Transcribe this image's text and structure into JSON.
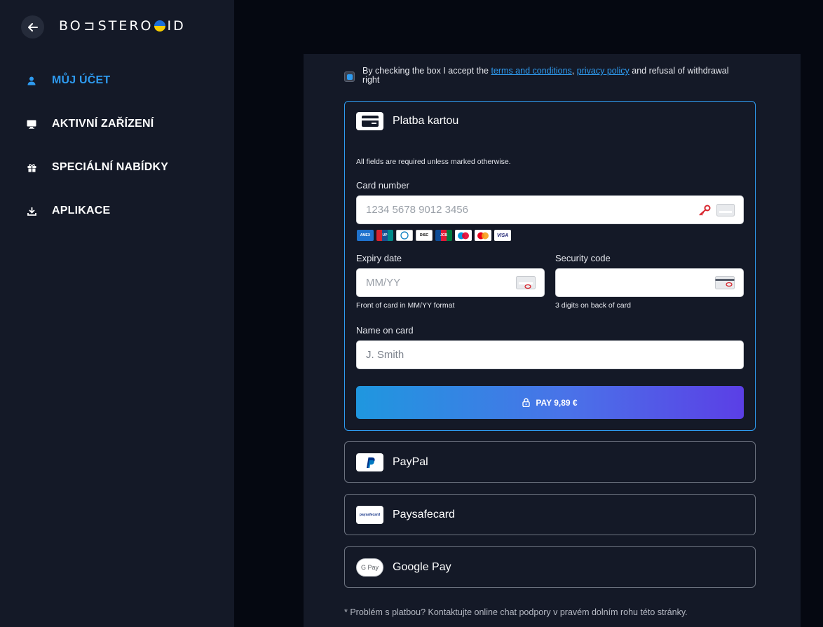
{
  "logo": {
    "before": "BO",
    "middle": "ST",
    "ost": "OSTERO",
    "text_left": "BO",
    "text_right": "STERO",
    "end": "ID"
  },
  "nav": [
    {
      "label": "MŮJ ÚČET",
      "icon": "user-icon",
      "active": true
    },
    {
      "label": "AKTIVNÍ ZAŘÍZENÍ",
      "icon": "monitor-icon",
      "active": false
    },
    {
      "label": "SPECIÁLNÍ NABÍDKY",
      "icon": "gift-icon",
      "active": false
    },
    {
      "label": "APLIKACE",
      "icon": "download-icon",
      "active": false
    }
  ],
  "consent": {
    "prefix": "By checking the box I accept the ",
    "terms": "terms and conditions",
    "comma": ",",
    "privacy": "privacy policy",
    "suffix": " and refusal of withdrawal right",
    "checked": true
  },
  "card_payment": {
    "title": "Platba kartou",
    "required_note": "All fields are required unless marked otherwise.",
    "card_number": {
      "label": "Card number",
      "placeholder": "1234 5678 9012 3456"
    },
    "brands": [
      "AMEX",
      "UnionPay",
      "Diners",
      "DISCOVER",
      "JCB",
      "Maestro",
      "Mastercard",
      "VISA"
    ],
    "expiry": {
      "label": "Expiry date",
      "placeholder": "MM/YY",
      "hint": "Front of card in MM/YY format"
    },
    "security": {
      "label": "Security code",
      "placeholder": "",
      "hint": "3 digits on back of card"
    },
    "name": {
      "label": "Name on card",
      "placeholder": "J. Smith"
    },
    "pay_button": "PAY 9,89 €"
  },
  "methods": [
    {
      "label": "PayPal",
      "icon": "paypal-icon"
    },
    {
      "label": "Paysafecard",
      "icon": "paysafecard-icon",
      "logo_text": "paysafecard"
    },
    {
      "label": "Google Pay",
      "icon": "google-pay-icon",
      "logo_text": "G Pay"
    }
  ],
  "footer_note": "* Problém s platbou? Kontaktujte online chat podpory v pravém dolním rohu této stránky.",
  "colors": {
    "accent": "#2e9bf0",
    "sidebar_bg": "#141927",
    "page_bg": "#050811"
  }
}
